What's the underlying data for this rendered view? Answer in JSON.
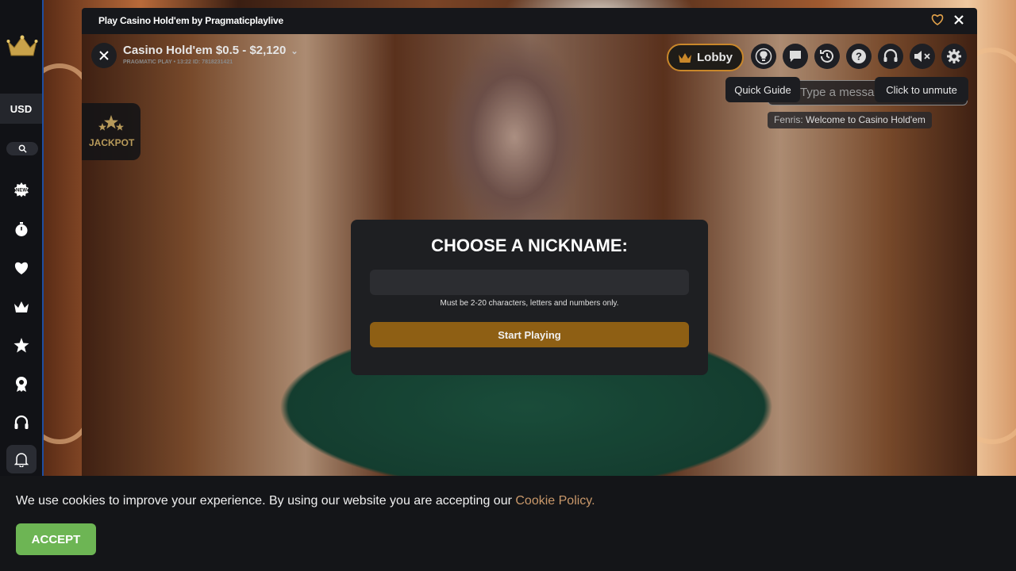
{
  "sidebar": {
    "currency": "USD",
    "icons": [
      "new-badge-icon",
      "stopwatch-icon",
      "heart-icon",
      "crown-icon",
      "star-icon",
      "award-icon",
      "headset-icon",
      "bell-icon"
    ]
  },
  "window": {
    "title": "Play Casino Hold'em by Pragmaticplaylive"
  },
  "game": {
    "name": "Casino Hold'em $0.5 - $2,120",
    "sub": "PRAGMATIC PLAY • 13:22  ID: 7818231421",
    "lobby_label": "Lobby",
    "tooltips": {
      "quick_guide": "Quick Guide",
      "unmute": "Click to unmute"
    },
    "chat_placeholder": "Type a message here",
    "chat_author": "Fenris:",
    "chat_message": "Welcome to Casino Hold'em",
    "jackpot_label": "JACKPOT"
  },
  "modal": {
    "title": "CHOOSE A NICKNAME:",
    "input_value": "",
    "hint": "Must be 2-20 characters, letters and numbers only.",
    "start_label": "Start Playing"
  },
  "cookie": {
    "text": "We use cookies to improve your experience. By using our website you are accepting our",
    "link": "Cookie Policy.",
    "accept_label": "ACCEPT"
  },
  "colors": {
    "accent_gold": "#c9872a",
    "start_button": "#8e5f14",
    "accept_green": "#6db554",
    "sidebar_border": "#1f4ea0"
  }
}
